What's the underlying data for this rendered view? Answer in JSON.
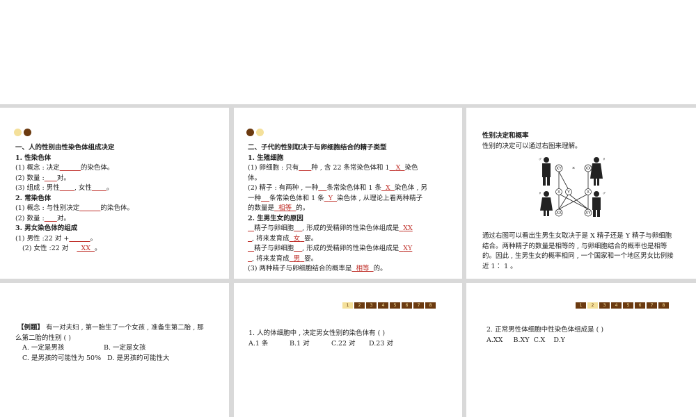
{
  "slide1": {
    "title": "一、人的性别由性染色体组成决定",
    "s1_heading": "1. 性染色体",
    "s1_l1a": "(1) 概念 : 决定",
    "s1_l1b": "的染色体。",
    "s1_l2a": "(2) 数量 :",
    "s1_l2b": "对。",
    "s1_l3a": "(3) 组成 : 男性",
    "s1_l3b": ", 女性",
    "s1_l3c": "。",
    "s2_heading": "2. 常染色体",
    "s2_l1a": "(1) 概念 : 与性别决定",
    "s2_l1b": "的染色体。",
    "s2_l2a": "(2) 数量 :",
    "s2_l2b": "对。",
    "s3_heading": "3. 男女染色体的组成",
    "s3_l1a": "(1) 男性 :22 对 +",
    "s3_l1b": "。",
    "s3_l2a": "(2) 女性 :22 对",
    "s3_l2_blank": "XX",
    "s3_l2b": "。"
  },
  "slide2": {
    "title": "二、子代的性别取决于与卵细胞结合的精子类型",
    "h1": "1. 生殖细胞",
    "l1a": "(1) 卵细胞 : 只有",
    "l1b": "种 , 含 22 条常染色体和 1",
    "l1_blank": "X",
    "l1c": "染色",
    "l1d": "体。",
    "l2a": "(2) 精子 : 有两种 , 一种",
    "l2b": "条常染色体和 1 条",
    "l2_blank1": "X",
    "l2c": "染色体 , 另",
    "l2d": "一种",
    "l2e": "条常染色体和 1 条",
    "l2_blank2": "Y",
    "l2f": "染色体 , 从理论上看两种精子",
    "l2g": "的数量是",
    "l2_blank3": "相等",
    "l2h": "的。",
    "h2": "2. 生男生女的原因",
    "l3a": "精子与卵细胞",
    "l3b": ", 形成的受精卵的性染色体组成是",
    "l3_blank1": "XX",
    "l3c": ", 将来发育成",
    "l3_blank2": "女",
    "l3d": "婴。",
    "l4a": "精子与卵细胞",
    "l4b": ", 形成的受精卵的性染色体组成是",
    "l4_blank1": "XY",
    "l4c": ", 将来发育成",
    "l4_blank2": "男",
    "l4d": "婴。",
    "l5a": "(3) 两种精子与卵细胞结合的概率是",
    "l5_blank": "相等",
    "l5b": "的。"
  },
  "slide3": {
    "title": "性别决定和概率",
    "subtitle": "性别的决定可以通过右图来理解。",
    "para1": "通过右图可以看出生男生女取决于是 X 精子还是 Y 精子与卵细胞",
    "para2": "结合。两种精子的数量是相等的 , 与卵细胞结合的概率也是相等",
    "para3": "的。因此 , 生男生女的概率相同 , 一个国家和一个地区男女比例接",
    "para4": "近 1∶ 1 。",
    "figure_labels": {
      "male_top": "XY",
      "female_top": "XX",
      "cross": "×",
      "sperm_x": "X",
      "sperm_y": "Y",
      "egg_x": "X",
      "child_female": "XX",
      "child_male": "XY",
      "male_symbol": "♂",
      "female_symbol": "♀"
    }
  },
  "slide4": {
    "example_label": "【例题】",
    "q_line1": "有一对夫妇 , 第一胎生了一个女孩 , 准备生第二胎 , 那",
    "q_line2": "么第二胎的性别 (          )",
    "opt_a": "A. 一定是男孩",
    "opt_b": "B. 一定是女孩",
    "opt_c": "C. 是男孩的可能性为 50%",
    "opt_d": "D. 是男孩的可能性大"
  },
  "slide5": {
    "pager": [
      "1",
      "2",
      "3",
      "4",
      "5",
      "6",
      "7",
      "8"
    ],
    "active_index": 0,
    "q": "1. 人的体细胞中 , 决定男女性别的染色体有 (  )",
    "options": [
      "A.1 条",
      "B.1 对",
      "C.22 对",
      "D.23 对"
    ]
  },
  "slide6": {
    "pager": [
      "1",
      "2",
      "3",
      "4",
      "5",
      "6",
      "7",
      "8"
    ],
    "active_index": 1,
    "q": "2. 正常男性体细胞中性染色体组成是 (  )",
    "options": "A.XX     B.XY  C.X    D.Y"
  }
}
